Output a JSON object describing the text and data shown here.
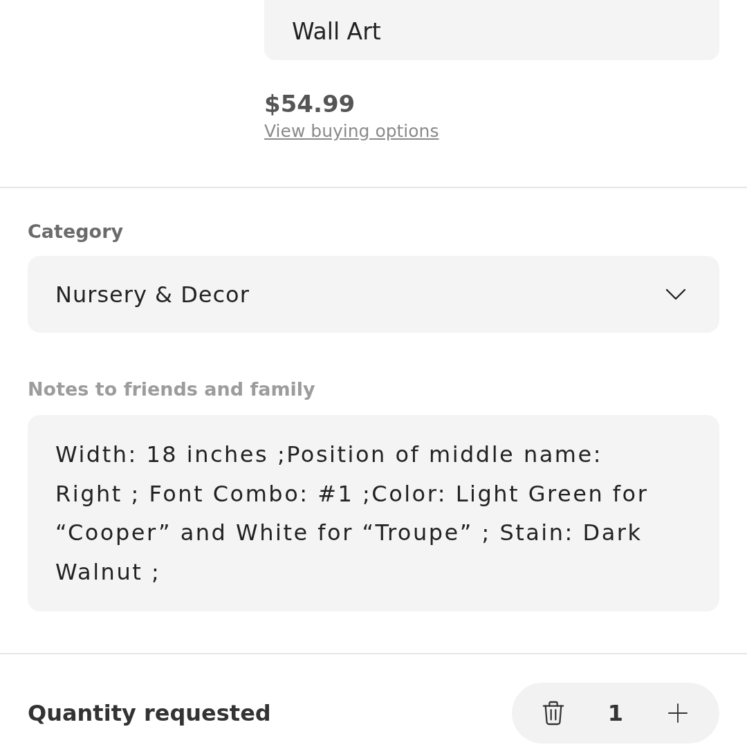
{
  "text_field": {
    "value": "Wall Art"
  },
  "price": {
    "amount": "$54.99",
    "link": "View buying options"
  },
  "category": {
    "label": "Category",
    "value": "Nursery & Decor"
  },
  "notes": {
    "label": "Notes to friends and family",
    "value": "Width: 18 inches ;Position of middle name: Right ; Font Combo: #1 ;Color: Light Green for “Cooper” and White for “Troupe” ; Stain: Dark Walnut ;"
  },
  "quantity": {
    "label": "Quantity requested",
    "value": "1"
  }
}
